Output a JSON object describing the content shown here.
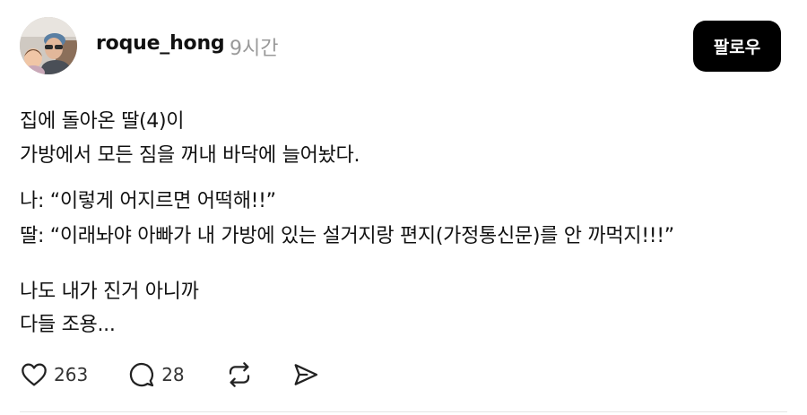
{
  "post": {
    "author": {
      "username": "roque_hong",
      "avatar_icon": "profile-photo"
    },
    "timestamp": "9시간",
    "follow_label": "팔로우",
    "body_lines": [
      "집에 돌아온 딸(4)이",
      "가방에서 모든 짐을 꺼내 바닥에 늘어놨다.",
      "나: “이렇게 어지르면 어떡해!!”",
      "딸: “이래놔야 아빠가 내 가방에 있는 설거지랑 편지(가정통신문)를 안 까먹지!!!”",
      "나도 내가 진거 아니까",
      "다들 조용..."
    ],
    "actions": {
      "like_icon": "heart-icon",
      "like_count": "263",
      "comment_icon": "comment-icon",
      "comment_count": "28",
      "repost_icon": "repost-icon",
      "share_icon": "send-icon"
    },
    "colors": {
      "text": "#111111",
      "muted": "#999999",
      "button_bg": "#000000",
      "button_text": "#ffffff"
    }
  }
}
